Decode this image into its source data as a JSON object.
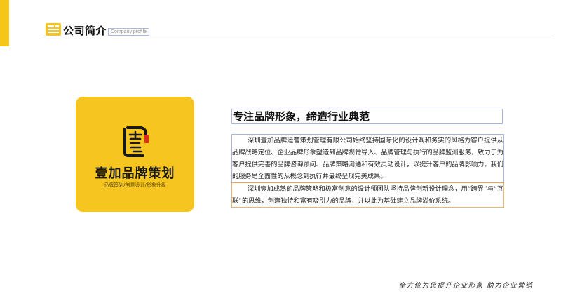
{
  "header": {
    "title": "公司简介",
    "subtitle": "Company profile",
    "icon": "document-icon"
  },
  "logo": {
    "glyph_char": "壹",
    "name": "壹加品牌策划",
    "tagline": "品牌策划/创意设计/形象升级"
  },
  "content": {
    "title": "专注品牌形象，缔造行业典范",
    "paragraphs": [
      "深圳壹加品牌运营策划管理有限公司始终坚持国际化的设计观和务实的风格为客户提供从品牌战略定位、企业品牌形象塑造到品牌视觉导入、品牌管理与执行的品牌监测服务，致力于为客户提供完善的品牌咨询顾问、品牌策略沟通和有效灵动设计，以提升客户的品牌影响力。我们的服务是全面性的从概念到执行并最终呈现完美成果。",
      "深圳壹加成熟的品牌策略和极富创意的设计师团队坚持品牌创新设计理念，用“跨界”与“互联”的思维，创造独特和富有吸引力的品牌，并以此为基础建立品牌溢价系统。"
    ]
  },
  "footer": {
    "slogan": "全方位为您提升企业形象 助力企业营销"
  },
  "colors": {
    "accent": "#f6c51f",
    "text": "#222222"
  }
}
